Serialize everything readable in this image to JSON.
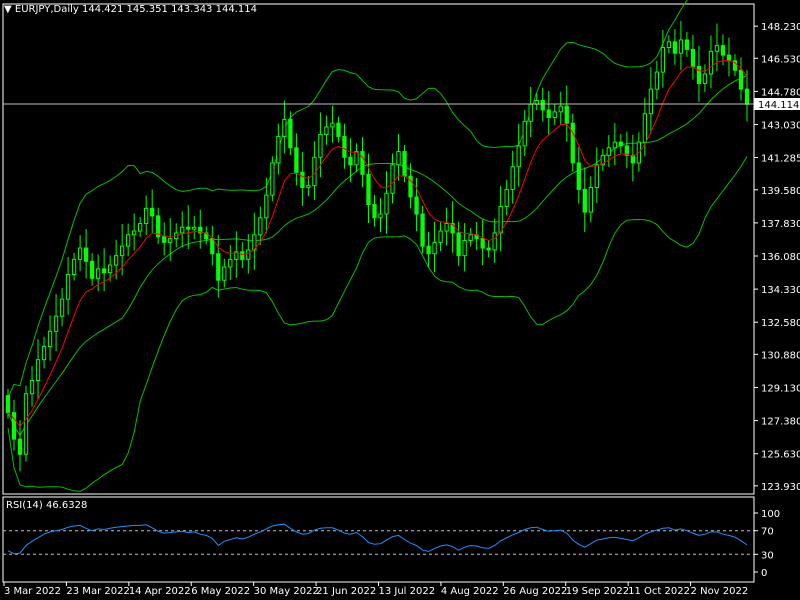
{
  "chart_data": {
    "type": "candlestick",
    "symbol": "EURJPY",
    "timeframe": "Daily",
    "last_ohlc": {
      "open": "144.421",
      "high": "145.351",
      "low": "143.343",
      "close": "144.114"
    },
    "current_price": "144.114",
    "price_axis_ticks": [
      "148.230",
      "146.530",
      "144.780",
      "143.030",
      "141.285",
      "139.580",
      "137.830",
      "136.080",
      "134.330",
      "132.580",
      "130.880",
      "129.130",
      "127.380",
      "125.630",
      "123.930"
    ],
    "price_range": [
      123.5,
      149.4
    ],
    "date_labels": [
      "3 Mar 2022",
      "23 Mar 2022",
      "14 Apr 2022",
      "6 May 2022",
      "30 May 2022",
      "21 Jun 2022",
      "13 Jul 2022",
      "4 Aug 2022",
      "26 Aug 2022",
      "19 Sep 2022",
      "11 Oct 2022",
      "2 Nov 2022"
    ],
    "indicators": [
      "Bollinger Bands",
      "Moving Average"
    ],
    "close_series": [
      127.8,
      126.4,
      125.6,
      128.8,
      129.5,
      130.6,
      131.3,
      132.1,
      132.9,
      133.8,
      135.1,
      135.9,
      136.5,
      135.8,
      134.9,
      135.4,
      135.2,
      135.6,
      136.1,
      136.6,
      137.2,
      137.4,
      137.8,
      138.6,
      138.2,
      137.1,
      136.8,
      137.0,
      137.3,
      137.6,
      137.5,
      137.6,
      137.3,
      137.0,
      136.2,
      134.8,
      135.5,
      135.9,
      136.3,
      135.9,
      136.4,
      137.2,
      138.1,
      139.3,
      141.0,
      142.4,
      143.3,
      141.8,
      140.5,
      139.7,
      139.8,
      141.3,
      142.5,
      142.9,
      143.1,
      142.4,
      141.3,
      140.9,
      141.6,
      140.4,
      138.8,
      138.1,
      138.3,
      139.4,
      140.9,
      141.6,
      140.3,
      139.2,
      138.3,
      136.6,
      136.2,
      136.8,
      137.4,
      137.8,
      137.3,
      136.1,
      136.9,
      137.2,
      137.0,
      136.5,
      136.4,
      137.3,
      138.7,
      139.6,
      140.8,
      141.9,
      143.2,
      144.1,
      144.3,
      143.8,
      143.4,
      143.7,
      144.0,
      143.1,
      141.0,
      139.6,
      138.4,
      139.7,
      140.9,
      141.4,
      141.8,
      142.1,
      141.9,
      141.4,
      141.0,
      142.1,
      143.6,
      144.9,
      145.8,
      147.1,
      147.4,
      146.8,
      147.5,
      147.0,
      146.1,
      145.2,
      145.7,
      146.9,
      147.2,
      146.7,
      146.4,
      145.9,
      144.9,
      144.1
    ],
    "rsi": {
      "label": "RSI(14) 46.6328",
      "period": 14,
      "value": "46.6328",
      "levels": [
        70,
        30
      ],
      "axis_ticks": [
        "100",
        "70",
        "30",
        "0"
      ],
      "series": [
        36,
        31,
        32,
        45,
        52,
        58,
        64,
        68,
        70,
        72,
        76,
        78,
        79,
        74,
        70,
        73,
        72,
        74,
        76,
        77,
        78,
        79,
        79,
        80,
        75,
        69,
        66,
        67,
        68,
        69,
        67,
        68,
        64,
        62,
        57,
        45,
        52,
        55,
        58,
        56,
        59,
        64,
        68,
        73,
        78,
        80,
        81,
        74,
        68,
        64,
        65,
        71,
        74,
        75,
        75,
        71,
        66,
        64,
        67,
        60,
        50,
        47,
        48,
        54,
        60,
        62,
        55,
        49,
        45,
        37,
        35,
        40,
        44,
        46,
        43,
        37,
        42,
        45,
        44,
        41,
        40,
        45,
        53,
        58,
        63,
        67,
        72,
        75,
        76,
        72,
        69,
        70,
        71,
        66,
        54,
        47,
        42,
        48,
        54,
        56,
        58,
        59,
        57,
        55,
        53,
        58,
        64,
        68,
        71,
        74,
        75,
        71,
        73,
        70,
        66,
        62,
        64,
        68,
        68,
        64,
        62,
        59,
        53,
        46
      ]
    }
  },
  "header": {
    "text": "EURJPY,Daily  144.421 145.351 143.343 144.114"
  },
  "colors": {
    "background": "#000000",
    "candle": "#00ff00",
    "ma": "#ff0000",
    "bands": "#00c000",
    "rsi": "#1e90ff",
    "axis": "#ffffff",
    "price_line": "#c0c0c0"
  }
}
